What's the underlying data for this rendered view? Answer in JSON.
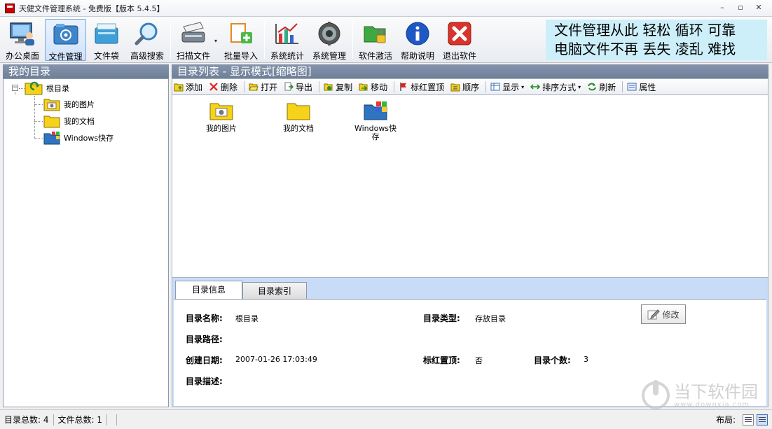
{
  "window": {
    "title": "天健文件管理系统 - 免费版【版本 5.4.5】",
    "min": "–",
    "max": "▫",
    "close": "✕"
  },
  "toolbar": {
    "office_desktop": "办公桌面",
    "file_manage": "文件管理",
    "file_bag": "文件袋",
    "advanced_search": "高级搜索",
    "scan_file": "扫描文件",
    "dropdown": "▾",
    "batch_import": "批量导入",
    "system_stats": "系统统计",
    "system_manage": "系统管理",
    "software_activate": "软件激活",
    "help": "帮助说明",
    "exit": "退出软件"
  },
  "slogan": {
    "line1": "文件管理从此 轻松 循环 可靠",
    "line2": "电脑文件不再 丢失 凌乱 难找"
  },
  "left_panel": {
    "title": "我的目录",
    "expander": "−",
    "tree": {
      "root": "根目录",
      "items": [
        "我的图片",
        "我的文档",
        "Windows快存"
      ]
    }
  },
  "right_panel": {
    "title": "目录列表 - 显示模式[缩略图]",
    "actions": {
      "add": "添加",
      "delete": "删除",
      "open": "打开",
      "export": "导出",
      "copy": "复制",
      "move": "移动",
      "pin_top": "标红置顶",
      "order": "顺序",
      "display": "显示",
      "sort": "排序方式",
      "refresh": "刷新",
      "properties": "属性",
      "dropdown": "▾"
    },
    "thumbnails": [
      "我的图片",
      "我的文档",
      "Windows快存"
    ]
  },
  "info": {
    "tabs": [
      "目录信息",
      "目录索引"
    ],
    "labels": {
      "name": "目录名称:",
      "type": "目录类型:",
      "path": "目录路径:",
      "created": "创建日期:",
      "pinned": "标红置顶:",
      "count": "目录个数:",
      "desc": "目录描述:"
    },
    "values": {
      "name": "根目录",
      "type": "存放目录",
      "created": "2007-01-26 17:03:49",
      "pinned": "否",
      "count": "3"
    },
    "edit_button": "修改"
  },
  "status": {
    "dir_total": "目录总数:  4",
    "file_total": "文件总数:  1",
    "layout": "布局:"
  },
  "watermark": {
    "cn": "当下软件园",
    "url": "www.downxia.com"
  },
  "colors": {
    "panel_head": "#7585a0",
    "info_bg": "#c8dcf7",
    "slogan_bg": "#cdeffa"
  }
}
